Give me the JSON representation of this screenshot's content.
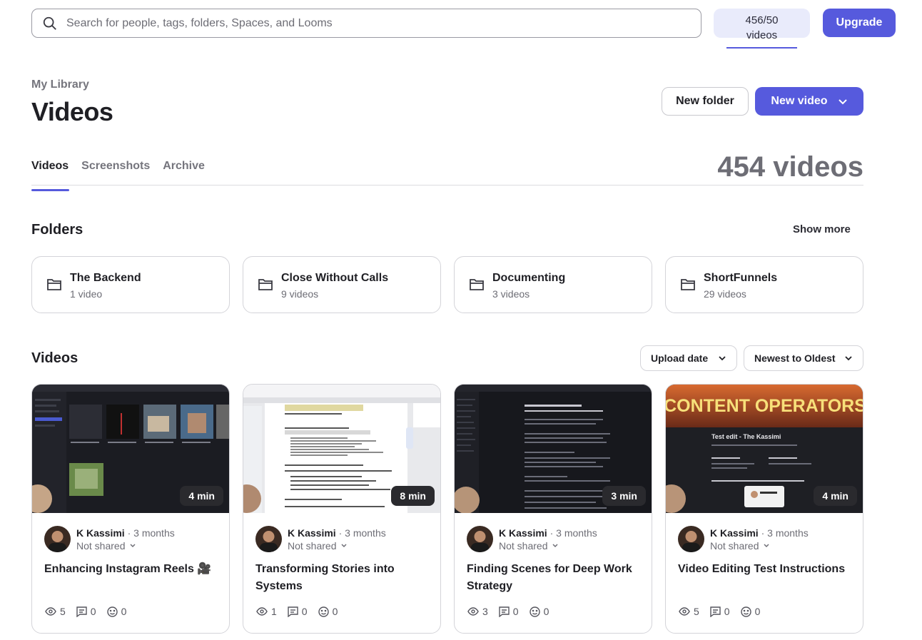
{
  "search": {
    "placeholder": "Search for people, tags, folders, Spaces, and Looms"
  },
  "quota": {
    "count": "456/50",
    "unit": "videos",
    "usage_fraction": 1.0
  },
  "upgrade_label": "Upgrade",
  "breadcrumb": "My Library",
  "page_title": "Videos",
  "actions": {
    "new_folder": "New folder",
    "new_video": "New video"
  },
  "tabs": [
    {
      "label": "Videos",
      "active": true
    },
    {
      "label": "Screenshots",
      "active": false
    },
    {
      "label": "Archive",
      "active": false
    }
  ],
  "video_count": "454 videos",
  "folders_section": {
    "title": "Folders",
    "show_more": "Show more"
  },
  "folders": [
    {
      "name": "The Backend",
      "count": "1 video"
    },
    {
      "name": "Close Without Calls",
      "count": "9 videos"
    },
    {
      "name": "Documenting",
      "count": "3 videos"
    },
    {
      "name": "ShortFunnels",
      "count": "29 videos"
    }
  ],
  "videos_section": {
    "title": "Videos",
    "sort_field": "Upload date",
    "sort_order": "Newest to Oldest"
  },
  "colors": {
    "accent": "#565add",
    "quota_bg": "#e9ebfb",
    "thumb_dark": "#1b1c22",
    "thumb_orange": "#d86a30"
  },
  "videos": [
    {
      "duration": "4 min",
      "author": "K Kassimi",
      "age": "· 3 months",
      "share": "Not shared",
      "title": "Enhancing Instagram Reels 🎥",
      "views": "5",
      "comments": "0",
      "reactions": "0",
      "thumb": "dark-grid"
    },
    {
      "duration": "8 min",
      "author": "K Kassimi",
      "age": "· 3 months",
      "share": "Not shared",
      "title": "Transforming Stories into Systems",
      "views": "1",
      "comments": "0",
      "reactions": "0",
      "thumb": "document"
    },
    {
      "duration": "3 min",
      "author": "K Kassimi",
      "age": "· 3 months",
      "share": "Not shared",
      "title": "Finding Scenes for Deep Work Strategy",
      "views": "3",
      "comments": "0",
      "reactions": "0",
      "thumb": "dark-doc"
    },
    {
      "duration": "4 min",
      "author": "K Kassimi",
      "age": "· 3 months",
      "share": "Not shared",
      "title": "Video Editing Test Instructions",
      "views": "5",
      "comments": "0",
      "reactions": "0",
      "thumb": "content-operators",
      "thumb_heading": "CONTENT OPERATORS",
      "thumb_subtitle": "Test edit - The Kassimi"
    }
  ]
}
